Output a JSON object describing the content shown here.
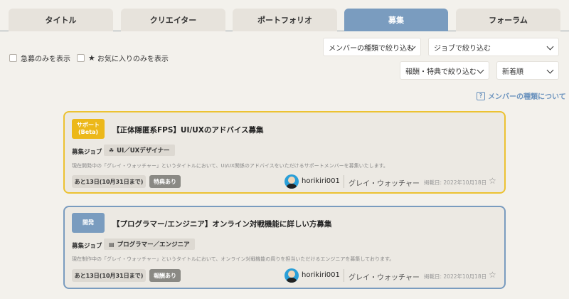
{
  "tabs": [
    {
      "label": "タイトル",
      "active": false
    },
    {
      "label": "クリエイター",
      "active": false
    },
    {
      "label": "ポートフォリオ",
      "active": false
    },
    {
      "label": "募集",
      "active": true
    },
    {
      "label": "フォーラム",
      "active": false
    }
  ],
  "filters": {
    "urgent_only": "急募のみを表示",
    "favorites_only": "お気に入りのみを表示",
    "member_type": "メンバーの種類で絞り込む",
    "job": "ジョブで絞り込む",
    "reward": "報酬・特典で絞り込む",
    "sort": "新着順"
  },
  "about_link": "メンバーの種類について",
  "cards": [
    {
      "badge": "サポート\n(Beta)",
      "title": "【正体隠匿系FPS】UI/UXのアドバイス募集",
      "job_label": "募集ジョブ",
      "job": "UI／UXデザイナー",
      "description": "現在開発中の「グレイ・ウォッチャー」というタイトルにおいて、UI/UX関係のアドバイスをいただけるサポートメンバーを募集いたします。",
      "deadline": "あと13日(10月31日まで)",
      "tag": "特典あり",
      "username": "horikiri001",
      "game": "グレイ・ウォッチャー",
      "date": "掲載日: 2022年10月18日"
    },
    {
      "badge": "開発",
      "title": "【プログラマー/エンジニア】オンライン対戦機能に詳しい方募集",
      "job_label": "募集ジョブ",
      "job": "プログラマー／エンジニア",
      "description": "現在制作中の「グレイ・ウォッチャー」というタイトルにおいて、オンライン対戦機能の周りを担当いただけるエンジニアを募集しております。",
      "deadline": "あと13日(10月31日まで)",
      "tag": "報酬あり",
      "username": "horikiri001",
      "game": "グレイ・ウォッチャー",
      "date": "掲載日: 2022年10月18日"
    }
  ]
}
